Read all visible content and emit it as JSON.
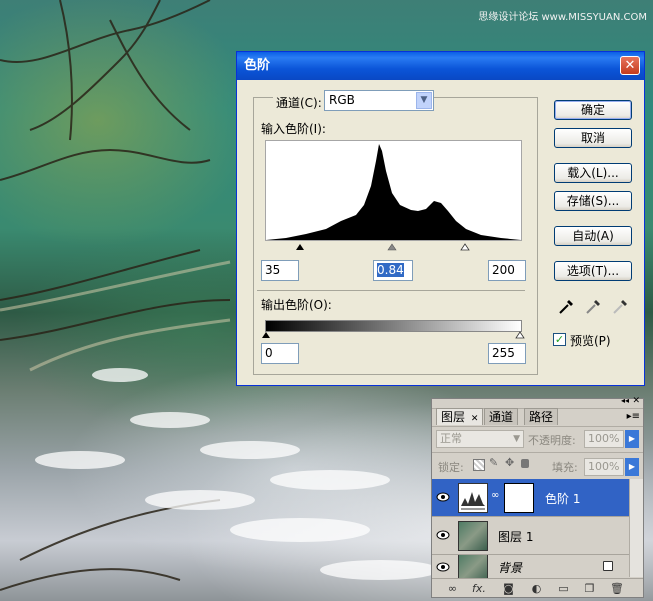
{
  "watermark": "思缘设计论坛 www.MISSYUAN.COM",
  "levels_dialog": {
    "title": "色阶",
    "channel_label": "通道(C):",
    "channel_value": "RGB",
    "input_levels_label": "输入色阶(I):",
    "input_black": "35",
    "input_gamma": "0.84",
    "input_white": "200",
    "output_levels_label": "输出色阶(O):",
    "output_black": "0",
    "output_white": "255",
    "buttons": {
      "ok": "确定",
      "cancel": "取消",
      "load": "载入(L)...",
      "save": "存储(S)...",
      "auto": "自动(A)",
      "options": "选项(T)..."
    },
    "preview_label": "预览(P)",
    "preview_checked": true
  },
  "layers_panel": {
    "tabs": [
      "图层",
      "通道",
      "路径"
    ],
    "blend_mode": "正常",
    "opacity_label": "不透明度:",
    "opacity_value": "100%",
    "lock_label": "锁定:",
    "fill_label": "填充:",
    "fill_value": "100%",
    "layers": [
      {
        "name": "色阶 1",
        "selected": true
      },
      {
        "name": "图层 1",
        "selected": false
      },
      {
        "name": "背景",
        "selected": false
      }
    ]
  }
}
